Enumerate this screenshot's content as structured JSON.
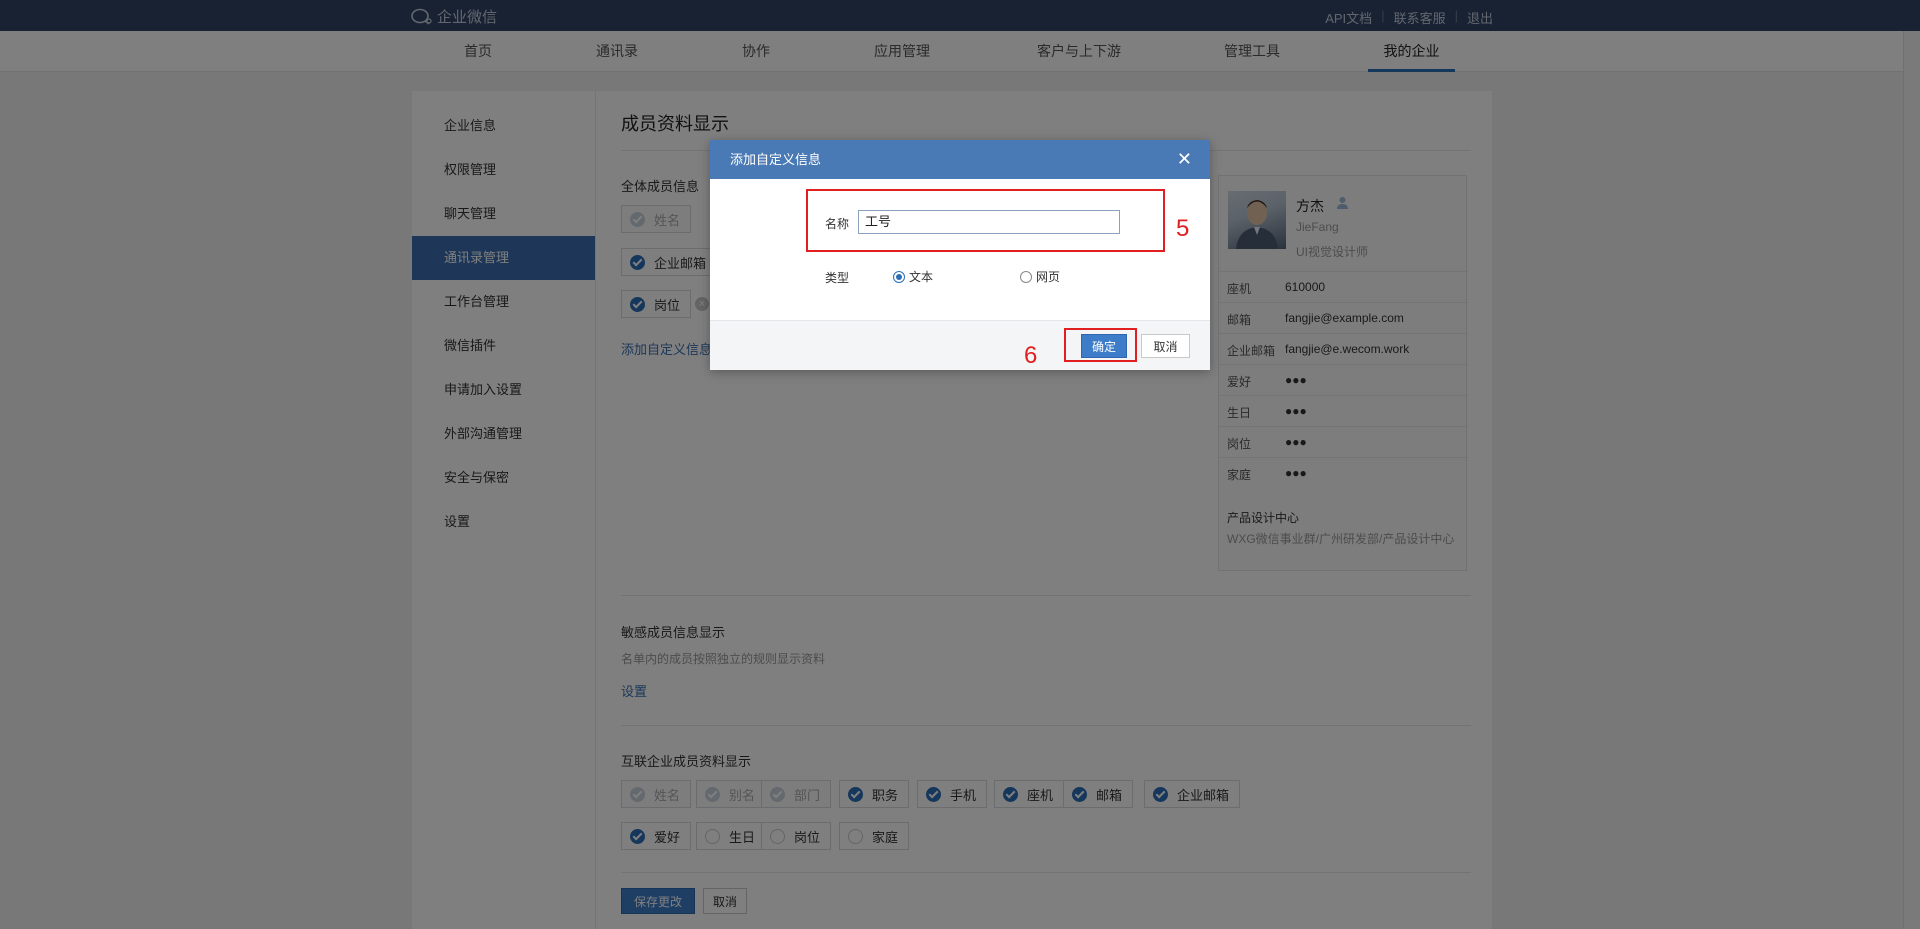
{
  "app": {
    "name": "企业微信"
  },
  "toplinks": [
    "API文档",
    "联系客服",
    "退出"
  ],
  "nav": {
    "tabs": [
      "首页",
      "通讯录",
      "协作",
      "应用管理",
      "客户与上下游",
      "管理工具",
      "我的企业"
    ],
    "active": "我的企业"
  },
  "sidebar": {
    "items": [
      "企业信息",
      "权限管理",
      "聊天管理",
      "通讯录管理",
      "工作台管理",
      "微信插件",
      "申请加入设置",
      "外部沟通管理",
      "安全与保密",
      "设置"
    ],
    "active": "通讯录管理"
  },
  "page": {
    "title": "成员资料显示",
    "all_members_label": "全体成员信息",
    "visible_chips": [
      "姓名",
      "企业邮箱",
      "岗位"
    ],
    "add_custom_link": "添加自定义信息",
    "sensitive": {
      "title": "敏感成员信息显示",
      "desc": "名单内的成员按照独立的规则显示资料",
      "link": "设置"
    },
    "interconnect": {
      "title": "互联企业成员资料显示",
      "row1": [
        {
          "label": "姓名",
          "state": "disabled"
        },
        {
          "label": "别名",
          "state": "disabled"
        },
        {
          "label": "部门",
          "state": "disabled"
        },
        {
          "label": "职务",
          "state": "on"
        },
        {
          "label": "手机",
          "state": "on"
        },
        {
          "label": "座机",
          "state": "on"
        },
        {
          "label": "邮箱",
          "state": "on"
        },
        {
          "label": "企业邮箱",
          "state": "on"
        }
      ],
      "row2": [
        {
          "label": "爱好",
          "state": "on"
        },
        {
          "label": "生日",
          "state": "off"
        },
        {
          "label": "岗位",
          "state": "off"
        },
        {
          "label": "家庭",
          "state": "off"
        }
      ]
    },
    "save_button": "保存更改",
    "cancel_button": "取消"
  },
  "preview": {
    "name": "方杰",
    "english_name": "JieFang",
    "role": "UI视觉设计师",
    "rows": [
      {
        "k": "座机",
        "v": "610000"
      },
      {
        "k": "邮箱",
        "v": "fangjie@example.com"
      },
      {
        "k": "企业邮箱",
        "v": "fangjie@e.wecom.work"
      },
      {
        "k": "爱好",
        "v": "●●●"
      },
      {
        "k": "生日",
        "v": "●●●"
      },
      {
        "k": "岗位",
        "v": "●●●"
      },
      {
        "k": "家庭",
        "v": "●●●"
      }
    ],
    "department": "产品设计中心",
    "path": "WXG微信事业群/广州研发部/产品设计中心"
  },
  "modal": {
    "title": "添加自定义信息",
    "close_icon": "close-icon",
    "name_label": "名称",
    "name_value": "工号",
    "type_label": "类型",
    "type_options": [
      "文本",
      "网页"
    ],
    "type_selected": "文本",
    "confirm_button": "确定",
    "cancel_button": "取消"
  },
  "annotations": {
    "step5": "5",
    "step6": "6"
  },
  "colors": {
    "topbar": "#304466",
    "accent": "#2d6fb8",
    "annotation": "#e02020"
  }
}
